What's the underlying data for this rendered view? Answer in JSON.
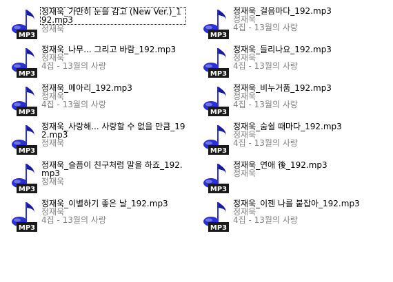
{
  "colors": {
    "icon_note": "#2b30d6",
    "icon_note_dark": "#151a9e",
    "badge_bg": "#1a1a1a",
    "badge_text": "#ffffff",
    "meta_text": "#808080"
  },
  "files": [
    {
      "name": "정재욱_가만히 눈을 감고 (New Ver.)_192.mp3",
      "artist": "정재욱",
      "album": "",
      "selected": true
    },
    {
      "name": "정재욱_걸음마다_192.mp3",
      "artist": "정재욱",
      "album": "4집 - 13월의 사랑"
    },
    {
      "name": "정재욱_나무... 그리고 바람_192.mp3",
      "artist": "정재욱",
      "album": "4집 - 13월의 사랑"
    },
    {
      "name": "정재욱_들리나요_192.mp3",
      "artist": "정재욱",
      "album": "4집 - 13월의 사랑"
    },
    {
      "name": "정재욱_메아리_192.mp3",
      "artist": "정재욱",
      "album": "4집 - 13월의 사랑"
    },
    {
      "name": "정재욱_비누거품_192.mp3",
      "artist": "정재욱",
      "album": "4집 - 13월의 사랑"
    },
    {
      "name": "정재욱_사랑해... 사랑할 수 없을 만큼_192.mp3",
      "artist": "정재욱",
      "album": ""
    },
    {
      "name": "정재욱_숨쉴 때마다_192.mp3",
      "artist": "정재욱",
      "album": "4집 - 13월의 사랑"
    },
    {
      "name": "정재욱_슬픔이 친구처럼 말을 하죠_192.mp3",
      "artist": "정재욱",
      "album": ""
    },
    {
      "name": "정재욱_연애 後_192.mp3",
      "artist": "정재욱",
      "album": ""
    },
    {
      "name": "정재욱_이별하기 좋은 날_192.mp3",
      "artist": "정재욱",
      "album": "4집 - 13월의 사랑"
    },
    {
      "name": "정재욱_이젠 나를 붙잡아_192.mp3",
      "artist": "정재욱",
      "album": "4집 - 13월의 사랑"
    }
  ],
  "icon": {
    "name": "mp3-file-icon",
    "badge": "MP3"
  }
}
